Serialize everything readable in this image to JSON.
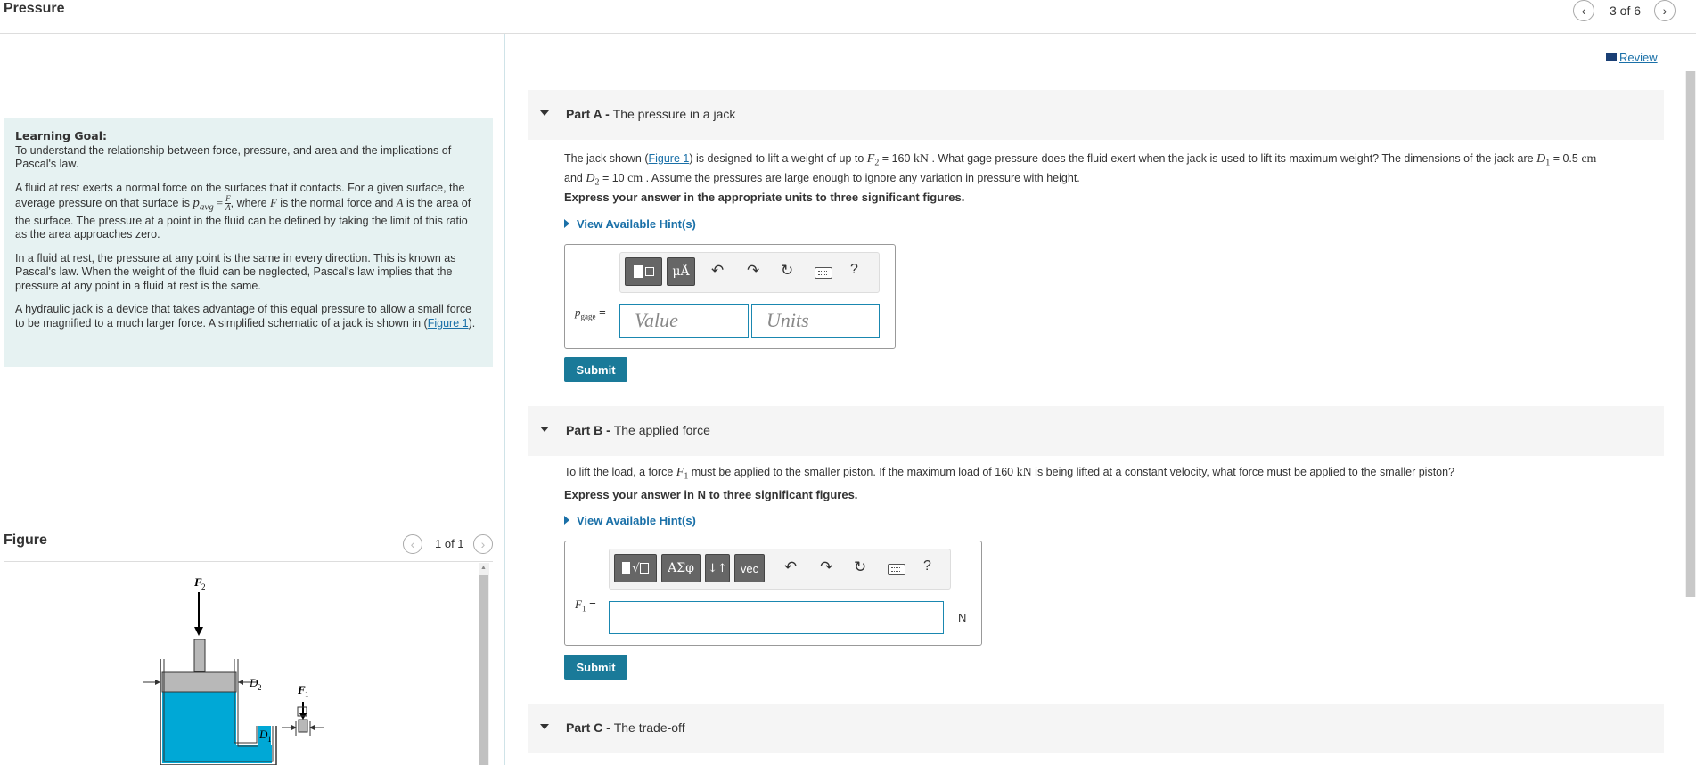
{
  "header": {
    "title": "Pressure",
    "page_counter": "3 of 6",
    "prev_icon": "chevron-left-icon",
    "next_icon": "chevron-right-icon"
  },
  "goal": {
    "heading": "Learning Goal:",
    "heading_text": "To understand the relationship between force, pressure, and area and the implications of Pascal's law.",
    "p1_a": "A fluid at rest exerts a normal force on the surfaces that it contacts. For a given surface, the average pressure on that surface is ",
    "p1_math": "p",
    "p1_sub": "avg",
    "p1_eq": " = ",
    "p1_frac_num": "F",
    "p1_frac_den": "A",
    "p1_b": ", where ",
    "p1_F": "F",
    "p1_c": " is the normal force and ",
    "p1_A": "A",
    "p1_d": " is the area of the surface. The pressure at a point in the fluid can be defined by taking the limit of this ratio as the area approaches zero.",
    "p2": "In a fluid at rest, the pressure at any point is the same in every direction. This is known as Pascal's law. When the weight of the fluid can be neglected, Pascal's law implies that the pressure at any point in a fluid at rest is the same.",
    "p3_a": "A hydraulic jack is a device that takes advantage of this equal pressure to allow a small force to be magnified to a much larger force. A simplified schematic of a jack is shown in (",
    "p3_link": "Figure 1",
    "p3_b": ")."
  },
  "figure": {
    "title": "Figure",
    "counter": "1 of 1",
    "labels": {
      "F2": "F",
      "F2_sub": "2",
      "D2": "D",
      "D2_sub": "2",
      "F1": "F",
      "F1_sub": "1",
      "D1": "D",
      "D1_sub": "1"
    },
    "colors": {
      "fluid": "#00a8d6",
      "piston": "#b8b8b8"
    }
  },
  "review": {
    "label": "Review",
    "icon": "book-icon"
  },
  "partA": {
    "label": "Part A - ",
    "title": "The pressure in a jack",
    "q_a": "The jack shown (",
    "q_link": "Figure 1",
    "q_b": ") is designed to lift a weight of up to ",
    "q_F2": "F",
    "q_F2_sub": "2",
    "q_c": " = 160  ",
    "q_kN": "kN",
    "q_d": " . What gage pressure does the fluid exert when the jack is used to lift its maximum weight? The dimensions of the jack are ",
    "q_D1": "D",
    "q_D1_sub": "1",
    "q_e": " = 0.5  ",
    "q_cm": "cm",
    "q_f": "and ",
    "q_D2": "D",
    "q_D2_sub": "2",
    "q_g": " = 10  ",
    "q_cm2": "cm",
    "q_h": " . Assume the pressures are large enough to ignore any variation in pressure with height.",
    "instruction": "Express your answer in the appropriate units to three significant figures.",
    "hint": "View Available Hint(s)",
    "var_label": "p",
    "var_sub": "gage",
    "var_eq": " =",
    "value_placeholder": "Value",
    "units_placeholder": "Units",
    "mu_btn": "μÅ",
    "help": "?",
    "submit": "Submit"
  },
  "partB": {
    "label": "Part B - ",
    "title": "The applied force",
    "q_a": "To lift the load, a force ",
    "q_F1": "F",
    "q_F1_sub": "1",
    "q_b": " must be applied to the smaller piston. If the maximum load of 160  ",
    "q_kN": "kN",
    "q_c": " is being lifted at a constant velocity, what force must be applied to the smaller piston?",
    "instruction": "Express your answer in N to three significant figures.",
    "hint": "View Available Hint(s)",
    "var_label": "F",
    "var_sub": "1",
    "var_eq": " =",
    "unit": "N",
    "sigma_btn": "ΑΣφ",
    "arrows_btn": "↓↑",
    "vec_btn": "vec",
    "help": "?",
    "submit": "Submit"
  },
  "partC": {
    "label": "Part C - ",
    "title": "The trade-off"
  }
}
